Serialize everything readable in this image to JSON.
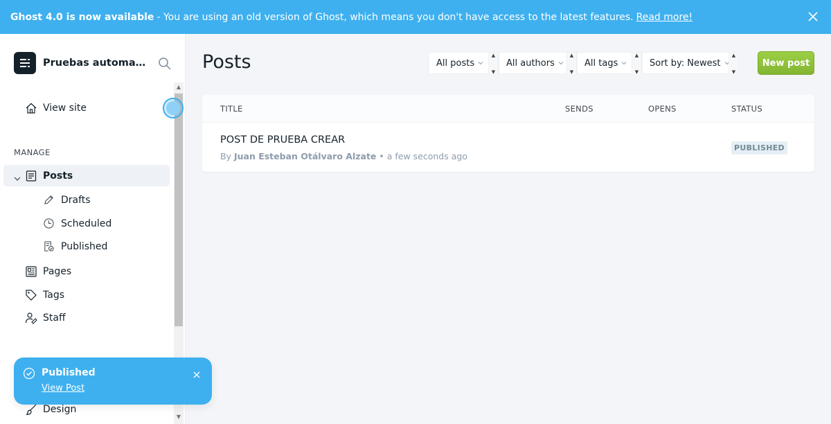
{
  "banner": {
    "headline": "Ghost 4.0 is now available",
    "message": "- You are using an old version of Ghost, which means you don't have access to the latest features.",
    "link": "Read more!"
  },
  "sidebar": {
    "site_title": "Pruebas automatizadas",
    "view_site": "View site",
    "manage_label": "MANAGE",
    "posts": "Posts",
    "drafts": "Drafts",
    "scheduled": "Scheduled",
    "published": "Published",
    "pages": "Pages",
    "tags": "Tags",
    "staff": "Staff",
    "design": "Design"
  },
  "main": {
    "title": "Posts",
    "filters": {
      "type": "All posts",
      "author": "All authors",
      "tag": "All tags",
      "sort": "Sort by: Newest"
    },
    "new_post": "New post",
    "table": {
      "headers": {
        "title": "TITLE",
        "sends": "SENDS",
        "opens": "OPENS",
        "status": "STATUS"
      },
      "rows": [
        {
          "title": "POST DE PRUEBA CREAR",
          "by": "By",
          "author": "Juan Esteban Otálvaro Alzate",
          "time": "• a few seconds ago",
          "status": "PUBLISHED"
        }
      ]
    }
  },
  "toast": {
    "title": "Published",
    "link": "View Post"
  },
  "colors": {
    "accent": "#3eb0ef",
    "primary_button": "#9ccf45"
  }
}
